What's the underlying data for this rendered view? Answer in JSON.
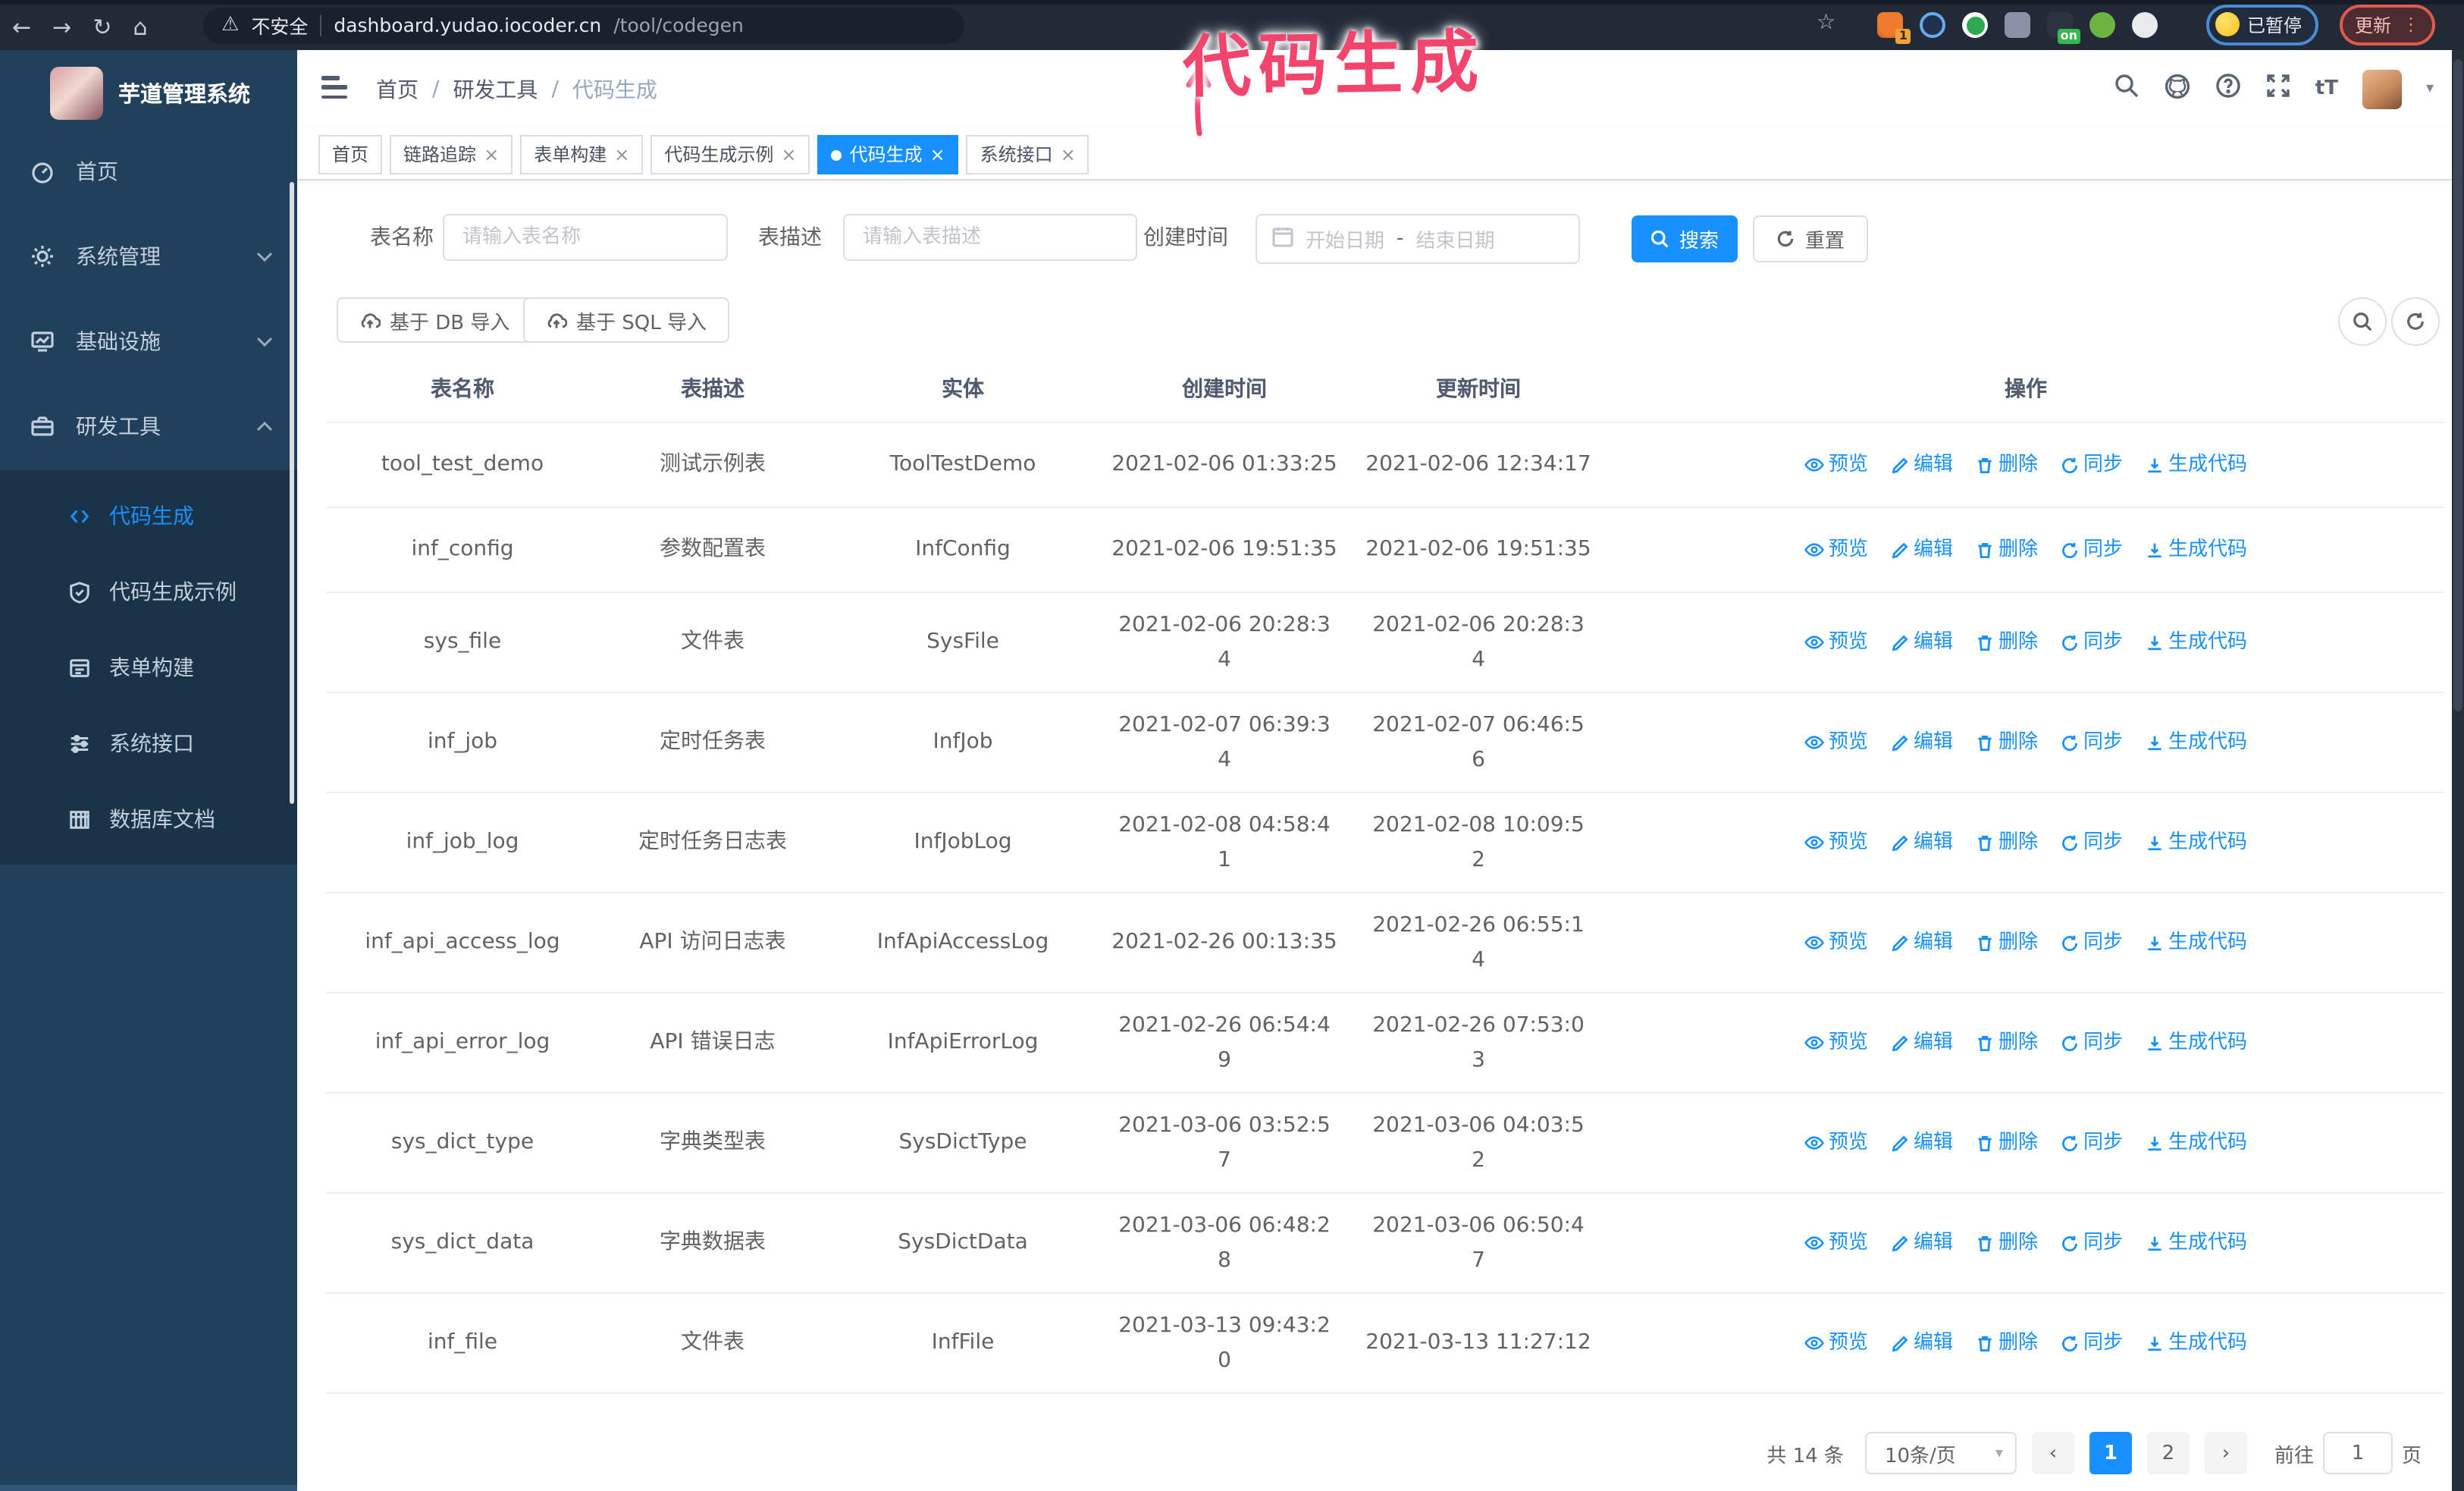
{
  "browser": {
    "insecure_label": "不安全",
    "url_host": "dashboard.yudao.iocoder.cn",
    "url_path": "/tool/codegen",
    "paused_badge": "已暂停",
    "update_button": "更新",
    "ext_badge_1": "1",
    "ext_badge_on": "on"
  },
  "icons": {
    "back": "←",
    "forward": "→",
    "reload": "↻",
    "home": "⌂",
    "warning": "⚠",
    "star": "☆",
    "dots": "⋮",
    "close": "×",
    "caret_down": "▾",
    "prev": "‹",
    "next": "›",
    "sep": "/",
    "dash": "-"
  },
  "annotation": {
    "text": "代码生成"
  },
  "sidebar": {
    "title": "芋道管理系统",
    "menu": [
      {
        "label": "首页"
      },
      {
        "label": "系统管理"
      },
      {
        "label": "基础设施"
      },
      {
        "label": "研发工具"
      }
    ],
    "submenu": [
      {
        "label": "代码生成"
      },
      {
        "label": "代码生成示例"
      },
      {
        "label": "表单构建"
      },
      {
        "label": "系统接口"
      },
      {
        "label": "数据库文档"
      }
    ]
  },
  "header": {
    "breadcrumb": [
      "首页",
      "研发工具",
      "代码生成"
    ]
  },
  "tabs": [
    {
      "label": "首页"
    },
    {
      "label": "链路追踪"
    },
    {
      "label": "表单构建"
    },
    {
      "label": "代码生成示例"
    },
    {
      "label": "代码生成"
    },
    {
      "label": "系统接口"
    }
  ],
  "filters": {
    "table_name_label": "表名称",
    "table_name_placeholder": "请输入表名称",
    "table_desc_label": "表描述",
    "table_desc_placeholder": "请输入表描述",
    "create_time_label": "创建时间",
    "date_start_placeholder": "开始日期",
    "date_end_placeholder": "结束日期",
    "search_label": "搜索",
    "reset_label": "重置"
  },
  "toolbar": {
    "import_db": "基于 DB 导入",
    "import_sql": "基于 SQL 导入"
  },
  "table": {
    "columns": [
      "表名称",
      "表描述",
      "实体",
      "创建时间",
      "更新时间",
      "操作"
    ],
    "actions": [
      "预览",
      "编辑",
      "删除",
      "同步",
      "生成代码"
    ],
    "rows": [
      {
        "name": "tool_test_demo",
        "desc": "测试示例表",
        "entity": "ToolTestDemo",
        "created": "2021-02-06 01:33:25",
        "updated": "2021-02-06 12:34:17"
      },
      {
        "name": "inf_config",
        "desc": "参数配置表",
        "entity": "InfConfig",
        "created": "2021-02-06 19:51:35",
        "updated": "2021-02-06 19:51:35"
      },
      {
        "name": "sys_file",
        "desc": "文件表",
        "entity": "SysFile",
        "created": "2021-02-06 20:28:3\n4",
        "updated": "2021-02-06 20:28:3\n4"
      },
      {
        "name": "inf_job",
        "desc": "定时任务表",
        "entity": "InfJob",
        "created": "2021-02-07 06:39:3\n4",
        "updated": "2021-02-07 06:46:5\n6"
      },
      {
        "name": "inf_job_log",
        "desc": "定时任务日志表",
        "entity": "InfJobLog",
        "created": "2021-02-08 04:58:4\n1",
        "updated": "2021-02-08 10:09:5\n2"
      },
      {
        "name": "inf_api_access_log",
        "desc": "API 访问日志表",
        "entity": "InfApiAccessLog",
        "created": "2021-02-26 00:13:35",
        "updated": "2021-02-26 06:55:1\n4"
      },
      {
        "name": "inf_api_error_log",
        "desc": "API 错误日志",
        "entity": "InfApiErrorLog",
        "created": "2021-02-26 06:54:4\n9",
        "updated": "2021-02-26 07:53:0\n3"
      },
      {
        "name": "sys_dict_type",
        "desc": "字典类型表",
        "entity": "SysDictType",
        "created": "2021-03-06 03:52:5\n7",
        "updated": "2021-03-06 04:03:5\n2"
      },
      {
        "name": "sys_dict_data",
        "desc": "字典数据表",
        "entity": "SysDictData",
        "created": "2021-03-06 06:48:2\n8",
        "updated": "2021-03-06 06:50:4\n7"
      },
      {
        "name": "inf_file",
        "desc": "文件表",
        "entity": "InfFile",
        "created": "2021-03-13 09:43:2\n0",
        "updated": "2021-03-13 11:27:12"
      }
    ]
  },
  "pagination": {
    "total": "共 14 条",
    "page_size": "10条/页",
    "pages": [
      "1",
      "2"
    ],
    "goto_label": "前往",
    "goto_value": "1",
    "page_label": "页"
  },
  "colors": {
    "accent": "#1890ff",
    "sidebar_bg": "#20405c",
    "submenu_bg": "#1a3349",
    "annotation": "#f3446e"
  }
}
